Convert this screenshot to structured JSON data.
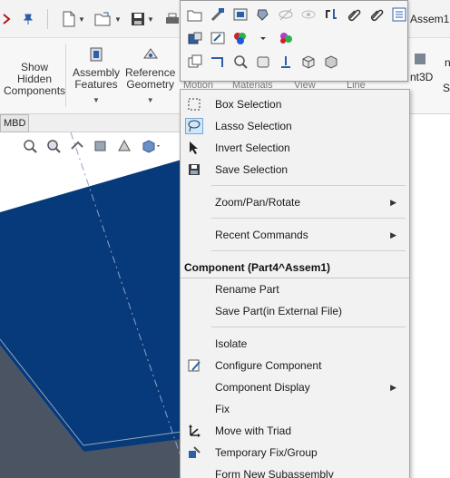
{
  "title_fragment": "Assem1",
  "ribbon": {
    "show_hidden": [
      "Show",
      "Hidden",
      "Components"
    ],
    "assembly_features": [
      "Assembly",
      "Features"
    ],
    "reference_geometry": [
      "Reference",
      "Geometry"
    ],
    "right_fragment": "nt3D",
    "far_right_fragment_1": "n",
    "far_right_fragment_2": "Sp"
  },
  "ribbon_tabs": [
    "Motion",
    "Materials",
    "View",
    "Line"
  ],
  "tab_mbd": "MBD",
  "colors": {
    "model_blue": "#063a7a",
    "model_edge": "#4b5462",
    "menu_bg": "#f2f2f2",
    "highlight": "#cce8ff"
  },
  "menu": {
    "items_top": [
      {
        "label": "Box Selection",
        "icon": "box-selection-icon"
      },
      {
        "label": "Lasso Selection",
        "icon": "lasso-selection-icon"
      },
      {
        "label": "Invert Selection",
        "icon": "invert-selection-icon"
      },
      {
        "label": "Save Selection",
        "icon": "save-selection-icon"
      }
    ],
    "zoom": "Zoom/Pan/Rotate",
    "recent": "Recent Commands",
    "section_header": "Component (Part4^Assem1)",
    "items_component": [
      {
        "label": "Rename Part"
      },
      {
        "label": "Save Part(in External File)"
      }
    ],
    "items_bottom": [
      {
        "label": "Isolate"
      },
      {
        "label": "Configure Component",
        "icon": "configure-component-icon"
      },
      {
        "label": "Component Display",
        "submenu": true
      },
      {
        "label": "Fix"
      },
      {
        "label": "Move with Triad",
        "icon": "move-triad-icon"
      },
      {
        "label": "Temporary Fix/Group",
        "icon": "temporary-fix-icon"
      },
      {
        "label": "Form New Subassembly"
      }
    ]
  }
}
